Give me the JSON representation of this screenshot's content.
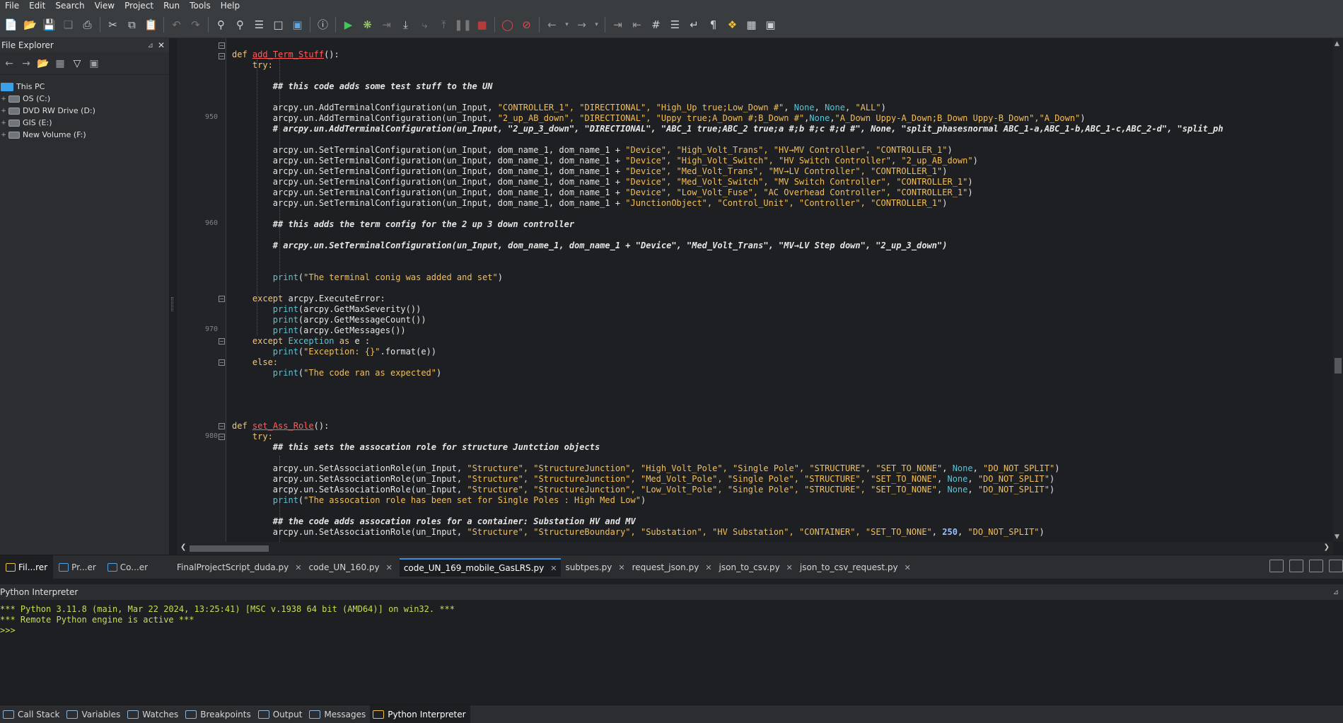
{
  "menu": [
    "File",
    "Edit",
    "Search",
    "View",
    "Project",
    "Run",
    "Tools",
    "Help"
  ],
  "toolbar": {
    "icons": [
      "new-file-icon",
      "open-file-icon",
      "save-icon",
      "save-all-icon",
      "print-icon",
      "cut-icon",
      "copy-icon",
      "paste-icon",
      "undo-icon",
      "redo-icon",
      "find-icon",
      "find-replace-icon",
      "find-in-files-icon",
      "bookmark-icon",
      "inspect-icon",
      "info-icon",
      "run-icon",
      "debug-icon",
      "run-to-cursor-icon",
      "step-into-icon",
      "step-over-icon",
      "step-out-icon",
      "pause-icon",
      "stop-icon",
      "breakpoint-icon",
      "clear-breakpoints-icon",
      "back-icon",
      "forward-icon",
      "indent-icon",
      "outdent-icon",
      "toggle-comment-icon",
      "list-icon",
      "wrap-icon",
      "pilcrow-icon",
      "python-icon",
      "layout-icon",
      "window-icon"
    ]
  },
  "file_explorer": {
    "title": "File Explorer",
    "items": [
      {
        "label": "This PC",
        "type": "pc"
      },
      {
        "label": "OS (C:)",
        "type": "drive"
      },
      {
        "label": "DVD RW Drive (D:)",
        "type": "drive"
      },
      {
        "label": "GIS (E:)",
        "type": "drive"
      },
      {
        "label": "New Volume (F:)",
        "type": "drive"
      }
    ]
  },
  "editor": {
    "line_numbers": [
      "950",
      "960",
      "970",
      "980"
    ],
    "code": {
      "def1": "def",
      "fn1": "add_Term_Stuff",
      "paren1": "():",
      "try1": "try:",
      "c1": "## this code adds some test stuff to the UN",
      "l1a": "arcpy.un.AddTerminalConfiguration(un_Input, ",
      "l1b": "\"CONTROLLER_1\", \"DIRECTIONAL\", \"High_Up true;Low_Down #\"",
      "l1c": ", ",
      "l1d": "None",
      "l1e": ", ",
      "l1f": "None",
      "l1g": ", ",
      "l1h": "\"ALL\"",
      "l1i": ")",
      "l2a": "arcpy.un.AddTerminalConfiguration(un_Input, ",
      "l2b": "\"2_up_AB_down\", \"DIRECTIONAL\", \"Uppy true;A_Down #;B_Down #\"",
      "l2c": ",",
      "l2d": "None",
      "l2e": ",",
      "l2f": "\"A_Down Uppy-A_Down;B_Down Uppy-B_Down\",\"A_Down\"",
      "l2g": ")",
      "l3": "# arcpy.un.AddTerminalConfiguration(un_Input, \"2_up_3_down\", \"DIRECTIONAL\", \"ABC_1 true;ABC_2 true;a #;b #;c #;d #\", None, \"split_phasesnormal ABC_1-a,ABC_1-b,ABC_1-c,ABC_2-d\", \"split_ph",
      "s_prefix": "arcpy.un.SetTerminalConfiguration(un_Input, dom_name_1, dom_name_1 + ",
      "s1": "\"Device\", \"High_Volt_Trans\", \"HV→MV Controller\", \"CONTROLLER_1\"",
      "s2": "\"Device\", \"High_Volt_Switch\", \"HV Switch Controller\", \"2_up_AB_down\"",
      "s3": "\"Device\", \"Med_Volt_Trans\", \"MV→LV Controller\", \"CONTROLLER_1\"",
      "s4": "\"Device\", \"Med_Volt_Switch\", \"MV Switch Controller\", \"CONTROLLER_1\"",
      "s5": "\"Device\", \"Low_Volt_Fuse\", \"AC Overhead Controller\", \"CONTROLLER_1\"",
      "s6": "\"JunctionObject\", \"Control_Unit\", \"Controller\", \"CONTROLLER_1\"",
      "close": ")",
      "c2": "## this adds the term config for the 2 up 3 down controller",
      "c3": "# arcpy.un.SetTerminalConfiguration(un_Input, dom_name_1, dom_name_1 + \"Device\", \"Med_Volt_Trans\", \"MV→LV Step down\", \"2_up_3_down\")",
      "print": "print",
      "p1": "\"The terminal conig was added and set\"",
      "except1": "except",
      "exc1": " arcpy.ExecuteError:",
      "pm1": "(arcpy.GetMaxSeverity())",
      "pm2": "(arcpy.GetMessageCount())",
      "pm3": "(arcpy.GetMessages())",
      "except2": "except",
      "exc2": "Exception",
      "as": "as",
      "e": " e :",
      "p2": "\"Exception: {}\"",
      "p2b": ".format(e))",
      "else": "else:",
      "p3": "\"The code ran as expected\"",
      "def2": "def",
      "fn2": "set_Ass_Role",
      "paren2": "():",
      "try2": "try:",
      "c4": "## this sets the assocation role for structure Juntction objects",
      "a_prefix": "arcpy.un.SetAssociationRole(un_Input, ",
      "a1": "\"Structure\", \"StructureJunction\", \"High_Volt_Pole\", \"Single Pole\", \"STRUCTURE\", \"SET_TO_NONE\"",
      "a2": "\"Structure\", \"StructureJunction\", \"Med_Volt_Pole\", \"Single Pole\", \"STRUCTURE\", \"SET_TO_NONE\"",
      "a3": "\"Structure\", \"StructureJunction\", \"Low_Volt_Pole\", \"Single Pole\", \"STRUCTURE\", \"SET_TO_NONE\"",
      "none": "None",
      "dns": "\"DO_NOT_SPLIT\"",
      "p4": "\"The assocation role has been set for Single Poles : High Med Low\"",
      "c5": "## the code adds assocation roles for a container: Substation HV and MV",
      "a4": "\"Structure\", \"StructureBoundary\", \"Substation\", \"HV Substation\", \"CONTAINER\", \"SET_TO_NONE\"",
      "n250": "250"
    }
  },
  "file_tabs": [
    "FinalProjectScript_duda.py",
    "code_UN_160.py",
    "code_UN_169_mobile_GasLRS.py",
    "subtpes.py",
    "request_json.py",
    "json_to_csv.py",
    "json_to_csv_request.py"
  ],
  "active_file_tab": "code_UN_169_mobile_GasLRS.py",
  "left_tabs": [
    "Fil...rer",
    "Pr...er",
    "Co...er"
  ],
  "interpreter": {
    "title": "Python Interpreter",
    "lines": [
      "*** Python 3.11.8 (main, Mar 22 2024, 13:25:41) [MSC v.1938 64 bit (AMD64)] on win32. ***",
      "*** Remote Python engine is active ***",
      ">>>"
    ]
  },
  "bottom_tabs": [
    "Call Stack",
    "Variables",
    "Watches",
    "Breakpoints",
    "Output",
    "Messages",
    "Python Interpreter"
  ],
  "colors": {
    "accent": "#3b8fe0",
    "keyword": "#f0c67a",
    "string": "#f3bf5a",
    "function_def": "#ff5c5c",
    "builtin": "#56c5d8",
    "interpreter_text": "#c7de57"
  }
}
